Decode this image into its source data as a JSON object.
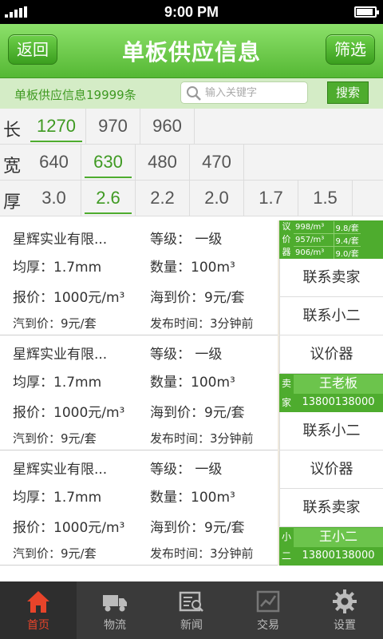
{
  "status": {
    "time": "9:00 PM"
  },
  "header": {
    "back_label": "返回",
    "title": "单板供应信息",
    "filter_label": "筛选"
  },
  "search": {
    "count_text": "单板供应信息19999条",
    "placeholder": "输入关键字",
    "button_label": "搜索"
  },
  "filters": [
    {
      "label": "长",
      "options": [
        "1270",
        "970",
        "960"
      ],
      "selected": 0
    },
    {
      "label": "宽",
      "options": [
        "640",
        "630",
        "480",
        "470"
      ],
      "selected": 1
    },
    {
      "label": "厚",
      "options": [
        "3.0",
        "2.6",
        "2.2",
        "2.0",
        "1.7",
        "1.5"
      ],
      "selected": 1
    }
  ],
  "items": [
    {
      "company": "星辉实业有限...",
      "grade": "等级：  一级",
      "thickness": "均厚：1.7mm",
      "quantity": "数量：100m³",
      "quote": "报价：1000元/m³",
      "sea_price": "海到价：9元/套",
      "truck_price": "汽到价：9元/套",
      "posted": "发布时间：3分钟前"
    },
    {
      "company": "星辉实业有限...",
      "grade": "等级：  一级",
      "thickness": "均厚：1.7mm",
      "quantity": "数量：100m³",
      "quote": "报价：1000元/m³",
      "sea_price": "海到价：9元/套",
      "truck_price": "汽到价：9元/套",
      "posted": "发布时间：3分钟前"
    },
    {
      "company": "星辉实业有限...",
      "grade": "等级：  一级",
      "thickness": "均厚：1.7mm",
      "quantity": "数量：100m³",
      "quote": "报价：1000元/m³",
      "sea_price": "海到价：9元/套",
      "truck_price": "汽到价：9元/套",
      "posted": "发布时间：3分钟前"
    }
  ],
  "side": {
    "price_tag": [
      "议",
      "价",
      "器"
    ],
    "price_rows": [
      [
        "998/m³",
        "9.8/套"
      ],
      [
        "957/m³",
        "9.4/套"
      ],
      [
        "906/m³",
        "9.0/套"
      ]
    ],
    "contact_seller": "联系卖家",
    "contact_agent": "联系小二",
    "bargain": "议价器",
    "seller_tag": [
      "卖",
      "家"
    ],
    "seller_name": "王老板",
    "seller_phone": "13800138000",
    "agent_tag": [
      "小",
      "二"
    ],
    "agent_name": "王小二",
    "agent_phone": "13800138000"
  },
  "tabs": [
    {
      "label": "首页",
      "icon": "home-icon",
      "active": true
    },
    {
      "label": "物流",
      "icon": "truck-icon",
      "active": false
    },
    {
      "label": "新闻",
      "icon": "news-icon",
      "active": false
    },
    {
      "label": "交易",
      "icon": "trade-icon",
      "active": false
    },
    {
      "label": "设置",
      "icon": "gear-icon",
      "active": false
    }
  ],
  "colors": {
    "accent": "#4eac2e",
    "header": "#6fcf4c",
    "active_tab": "#e8442a"
  }
}
